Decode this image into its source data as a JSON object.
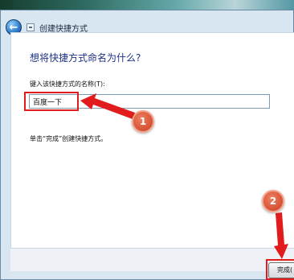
{
  "window": {
    "title": "创建快捷方式"
  },
  "page": {
    "heading": "想将快捷方式命名为什么?",
    "field_label": "键入该快捷方式的名称(T):",
    "name_value": "百度一下",
    "hint": "单击“完成”创建快捷方式。"
  },
  "footer": {
    "finish_label": "完成("
  },
  "annotations": {
    "step1": "1",
    "step2": "2",
    "accent_color": "#e21c1c",
    "badge_color": "#d9583a"
  },
  "icons": {
    "back": "back-arrow-icon",
    "window": "shortcut-wizard-icon"
  }
}
